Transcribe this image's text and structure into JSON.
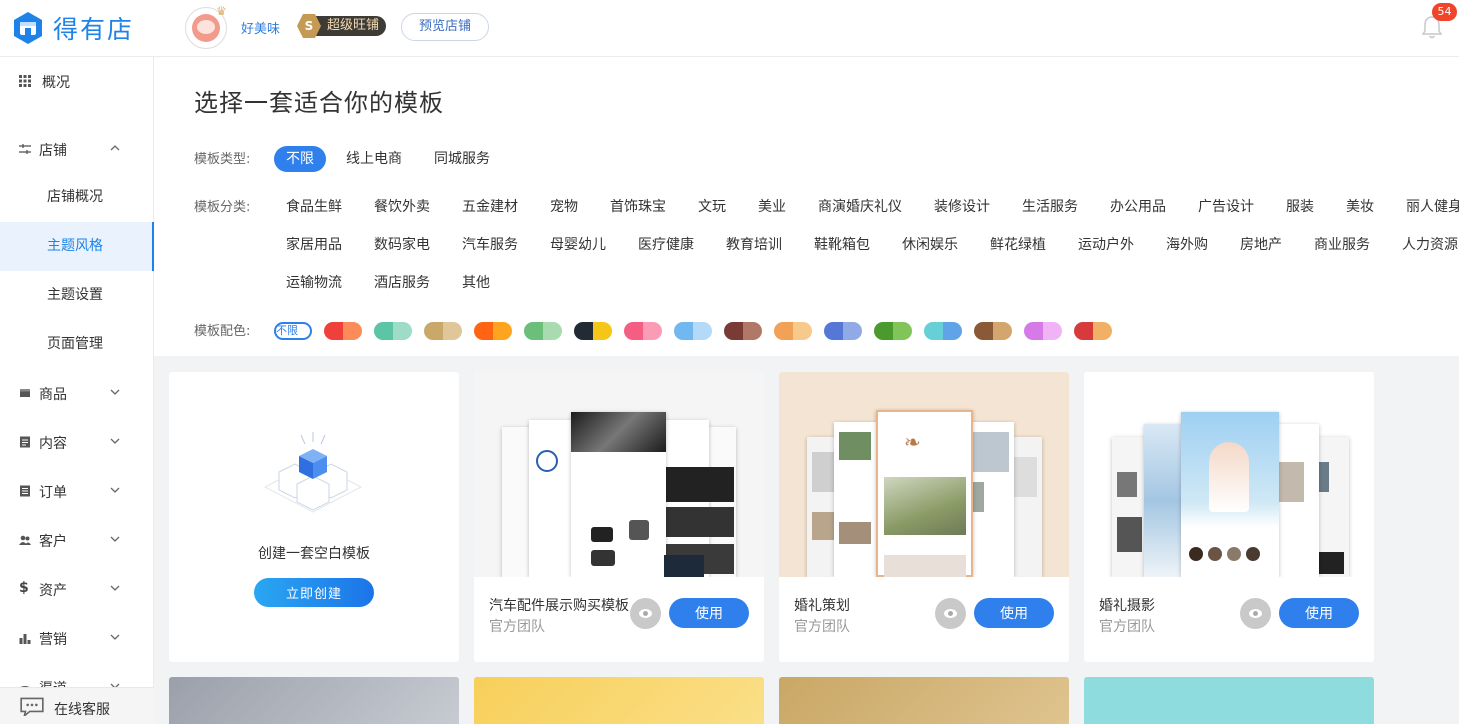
{
  "app": {
    "name": "得有店"
  },
  "header": {
    "shop_name": "好美味",
    "shop_badge": "S",
    "badge_label": "超级旺铺",
    "preview_label": "预览店铺",
    "notif_count": "54"
  },
  "sidebar": {
    "items": [
      {
        "label": "概况"
      },
      {
        "label": "店铺"
      },
      {
        "label": "商品"
      },
      {
        "label": "内容"
      },
      {
        "label": "订单"
      },
      {
        "label": "客户"
      },
      {
        "label": "资产"
      },
      {
        "label": "营销"
      },
      {
        "label": "渠道"
      }
    ],
    "store_sub": [
      {
        "label": "店铺概况"
      },
      {
        "label": "主题风格",
        "active": true
      },
      {
        "label": "主题设置"
      },
      {
        "label": "页面管理"
      }
    ],
    "service_label": "在线客服"
  },
  "main": {
    "title": "选择一套适合你的模板",
    "type_label": "模板类型:",
    "types": [
      "不限",
      "线上电商",
      "同城服务"
    ],
    "category_label": "模板分类:",
    "categories": [
      "食品生鲜",
      "餐饮外卖",
      "五金建材",
      "宠物",
      "首饰珠宝",
      "文玩",
      "美业",
      "商演婚庆礼仪",
      "装修设计",
      "生活服务",
      "办公用品",
      "广告设计",
      "服装",
      "美妆",
      "丽人健身",
      "家居用品",
      "数码家电",
      "汽车服务",
      "母婴幼儿",
      "医疗健康",
      "教育培训",
      "鞋靴箱包",
      "休闲娱乐",
      "鲜花绿植",
      "运动户外",
      "海外购",
      "房地产",
      "商业服务",
      "人力资源",
      "运输物流",
      "酒店服务",
      "其他"
    ],
    "color_label": "模板配色:",
    "color_none": "不限",
    "swatches": [
      [
        "#f0403c",
        "#fb8c5a"
      ],
      [
        "#5bc5a6",
        "#9fdcc7"
      ],
      [
        "#c9a86a",
        "#dfc79a"
      ],
      [
        "#ff6414",
        "#ffa41f"
      ],
      [
        "#6bbf7a",
        "#a8dcb0"
      ],
      [
        "#222a33",
        "#f5c518"
      ],
      [
        "#f55d82",
        "#fb9cb6"
      ],
      [
        "#72b8f0",
        "#b4daf7"
      ],
      [
        "#7a3a36",
        "#b07867"
      ],
      [
        "#f2a256",
        "#f7c98a"
      ],
      [
        "#5578d6",
        "#8faae7"
      ],
      [
        "#4b9a2e",
        "#80c45a"
      ],
      [
        "#67cfd8",
        "#60a3e6"
      ],
      [
        "#8a5a38",
        "#d3a66e"
      ],
      [
        "#d67ae8",
        "#f0b3f5"
      ],
      [
        "#d63a3a",
        "#f0b066"
      ]
    ],
    "blank": {
      "title": "创建一套空白模板",
      "button": "立即创建"
    },
    "templates": [
      {
        "name": "汽车配件展示购买模板",
        "author": "官方团队",
        "button": "使用"
      },
      {
        "name": "婚礼策划",
        "author": "官方团队",
        "button": "使用"
      },
      {
        "name": "婚礼摄影",
        "author": "官方团队",
        "button": "使用"
      }
    ]
  }
}
